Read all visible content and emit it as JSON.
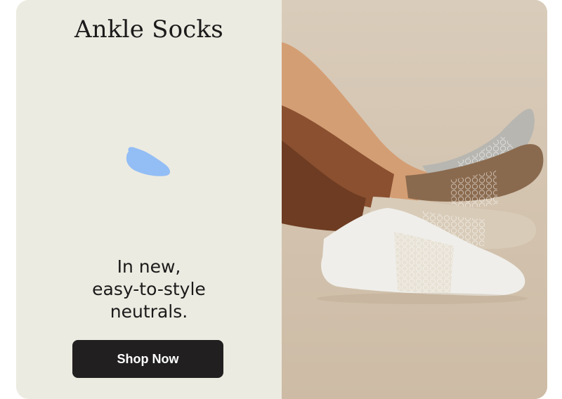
{
  "promo": {
    "title": "Ankle Socks",
    "tagline_lines": [
      "In new,",
      "easy-to-style",
      "neutrals."
    ],
    "cta_label": "Shop Now",
    "sock_icon": "ankle-sock-icon",
    "photo_icon": "socks-photo",
    "colors": {
      "panel_bg": "#ecebe1",
      "icon_blue": "#93bdf5",
      "cta_bg": "#221f20",
      "photo_bg": "#d4c6b3"
    }
  }
}
